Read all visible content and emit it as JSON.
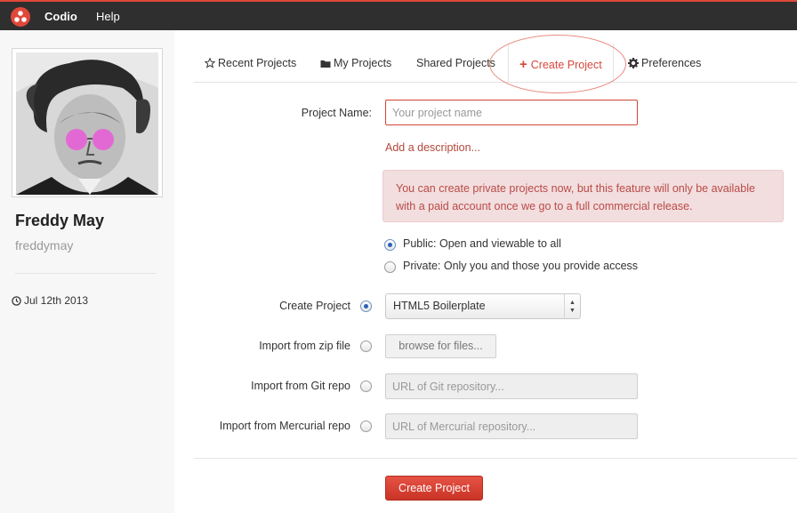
{
  "topbar": {
    "brand": "Codio",
    "help": "Help"
  },
  "user": {
    "name": "Freddy May",
    "handle": "freddymay",
    "joined": "Jul 12th 2013"
  },
  "tabs": [
    {
      "label": "Recent Projects",
      "icon": "star-outline-icon"
    },
    {
      "label": "My Projects",
      "icon": "folder-icon"
    },
    {
      "label": "Shared Projects",
      "icon": ""
    },
    {
      "label": "Create Project",
      "icon": "plus-icon",
      "active": true
    },
    {
      "label": "Preferences",
      "icon": "gear-icon"
    }
  ],
  "form": {
    "project_name_label": "Project Name:",
    "project_name_placeholder": "Your project name",
    "project_name_value": "",
    "add_description": "Add a description...",
    "alert_text": "You can create private projects now, but this feature will only be available with a paid account once we go to a full commercial release.",
    "visibility": [
      {
        "label": "Public: Open and viewable to all",
        "checked": true
      },
      {
        "label": "Private: Only you and those you provide access",
        "checked": false
      }
    ],
    "sources": {
      "create": {
        "label": "Create Project",
        "selected": "HTML5 Boilerplate",
        "checked": true
      },
      "zip": {
        "label": "Import from zip file",
        "button": "browse for files...",
        "checked": false
      },
      "git": {
        "label": "Import from Git repo",
        "placeholder": "URL of Git repository...",
        "checked": false
      },
      "hg": {
        "label": "Import from Mercurial repo",
        "placeholder": "URL of Mercurial repository...",
        "checked": false
      }
    },
    "submit": "Create Project"
  },
  "colors": {
    "accent": "#d6483b",
    "topbar": "#2f2f2f",
    "alert_bg": "#f2dede",
    "alert_text": "#b94a48",
    "link": "#b1473b",
    "highlight_ring": "#e98a7e"
  }
}
